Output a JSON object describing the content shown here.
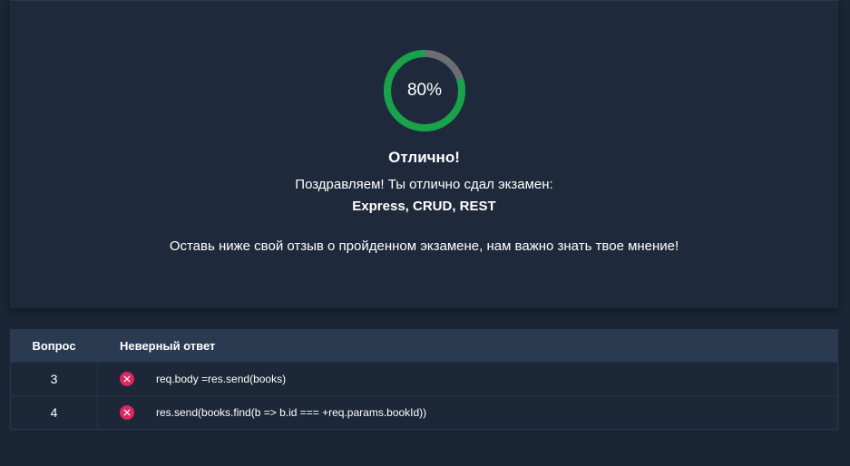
{
  "result": {
    "progress_percent": 80,
    "progress_label": "80%",
    "title": "Отлично!",
    "congrats": "Поздравляем! Ты отлично сдал экзамен:",
    "exam_name": "Express, CRUD, REST",
    "feedback_prompt": "Оставь ниже свой отзыв о пройденном экзамене, нам важно знать твое мнение!",
    "colors": {
      "progress_fill": "#16a34a",
      "progress_track": "#6b6e73"
    }
  },
  "table": {
    "headers": {
      "question": "Вопрос",
      "answer": "Неверный ответ"
    },
    "rows": [
      {
        "question": "3",
        "answer": "req.body =res.send(books)",
        "status_icon": "x-circle-icon"
      },
      {
        "question": "4",
        "answer": "res.send(books.find(b => b.id === +req.params.bookId))",
        "status_icon": "x-circle-icon"
      }
    ],
    "wrong_icon_color": "#e0245e"
  }
}
